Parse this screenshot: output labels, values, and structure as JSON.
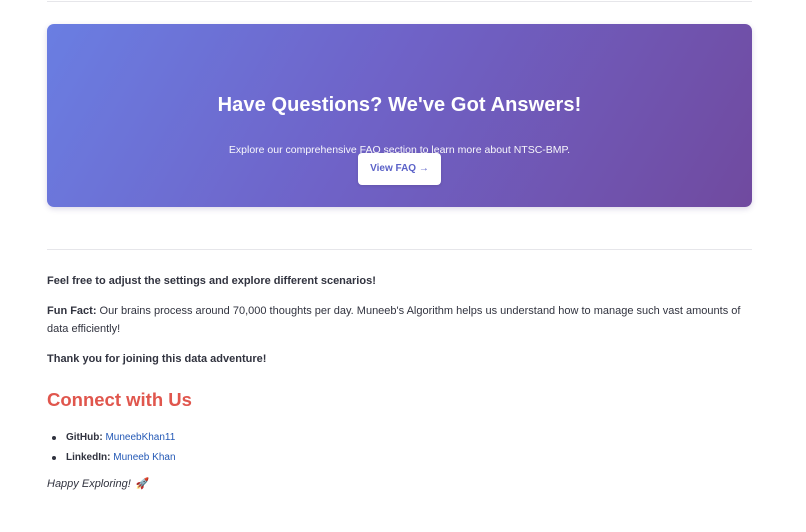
{
  "faq": {
    "title": "Have Questions? We've Got Answers!",
    "subtitle": "Explore our comprehensive FAQ section to learn more about NTSC-BMP.",
    "button_label": "View FAQ →"
  },
  "content": {
    "settings_note": "Feel free to adjust the settings and explore different scenarios!",
    "fun_fact_label": "Fun Fact:",
    "fun_fact_text": " Our brains process around 70,000 thoughts per day. Muneeb's Algorithm helps us understand how to manage such vast amounts of data efficiently!",
    "thanks": "Thank you for joining this data adventure!"
  },
  "connect": {
    "title": "Connect with Us",
    "items": [
      {
        "label": "GitHub:",
        "link_text": "MuneebKhan11"
      },
      {
        "label": "LinkedIn:",
        "link_text": "Muneeb Khan"
      }
    ]
  },
  "footer": {
    "happy_text": "Happy Exploring!",
    "rocket_icon": "🚀"
  },
  "colors": {
    "gradient_start": "#6a7ee2",
    "gradient_end": "#704a9f",
    "heading_red": "#e0564d",
    "link_blue": "#2459b6"
  }
}
